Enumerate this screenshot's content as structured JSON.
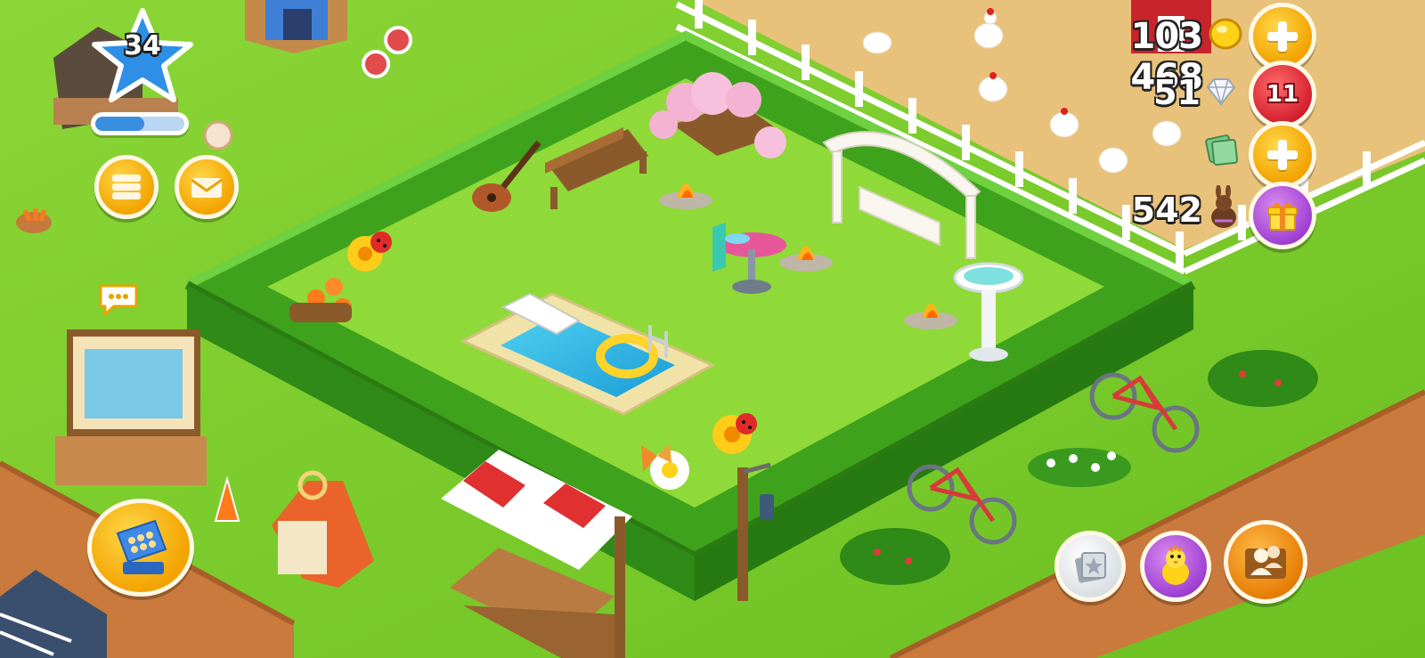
{
  "player": {
    "level": "34",
    "xp_progress": 0.55
  },
  "resources": {
    "coins": "103 468",
    "diamonds": "51",
    "diamonds_badge": "11",
    "eggs": "542"
  },
  "icons": {
    "coin": "coin-icon",
    "diamond": "diamond-icon",
    "cash": "cash-icon",
    "chocolate_bunny": "chocolate-bunny-icon",
    "gift": "gift-icon",
    "friends": "friends-icon",
    "chick": "chick-icon",
    "cards": "cards-icon",
    "cash_register": "cash-register-icon",
    "newspaper": "newspaper-icon",
    "mail": "mail-icon",
    "chat": "chat-bubble-icon",
    "star": "level-star-icon"
  },
  "colors": {
    "grass": "#7ccf2a",
    "hedge": "#3fa21c",
    "path": "#c97a3c",
    "accent_yellow": "#f3a300",
    "badge_red": "#d11b2a",
    "gift_purple": "#9b3bd0"
  }
}
